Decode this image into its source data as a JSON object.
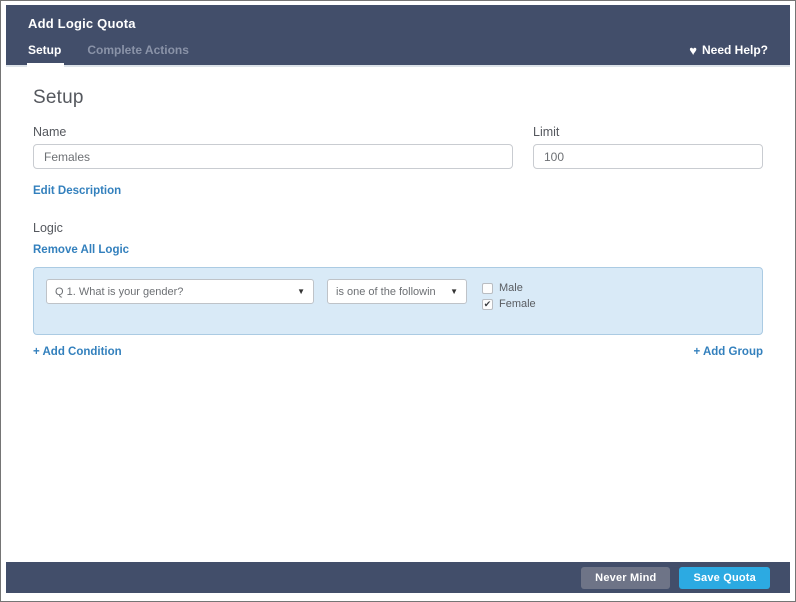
{
  "modal": {
    "title": "Add Logic Quota",
    "tabs": [
      {
        "label": "Setup",
        "active": true
      },
      {
        "label": "Complete Actions",
        "active": false
      }
    ],
    "help": {
      "label": "Need Help?",
      "icon": "heart-icon"
    }
  },
  "setup": {
    "heading": "Setup",
    "name_label": "Name",
    "name_value": "Females",
    "limit_label": "Limit",
    "limit_value": "100",
    "edit_description_label": "Edit Description"
  },
  "logic": {
    "heading": "Logic",
    "remove_all_label": "Remove All Logic",
    "condition": {
      "question_select_value": "Q 1. What is your gender?",
      "operator_select_value": "is one of the followin",
      "caret_icon": "chevron-down-icon",
      "options": [
        {
          "label": "Male",
          "checked": false
        },
        {
          "label": "Female",
          "checked": true
        }
      ]
    },
    "add_condition_label": "+ Add Condition",
    "add_group_label": "+ Add Group"
  },
  "footer": {
    "never_mind_label": "Never Mind",
    "save_label": "Save Quota"
  },
  "colors": {
    "header_bg": "#424e6a",
    "link_blue": "#3380bd",
    "save_button": "#2caae2",
    "never_mind_button": "#6e7487",
    "logic_box_bg": "#d9eaf7",
    "logic_box_border": "#abcbe3"
  }
}
